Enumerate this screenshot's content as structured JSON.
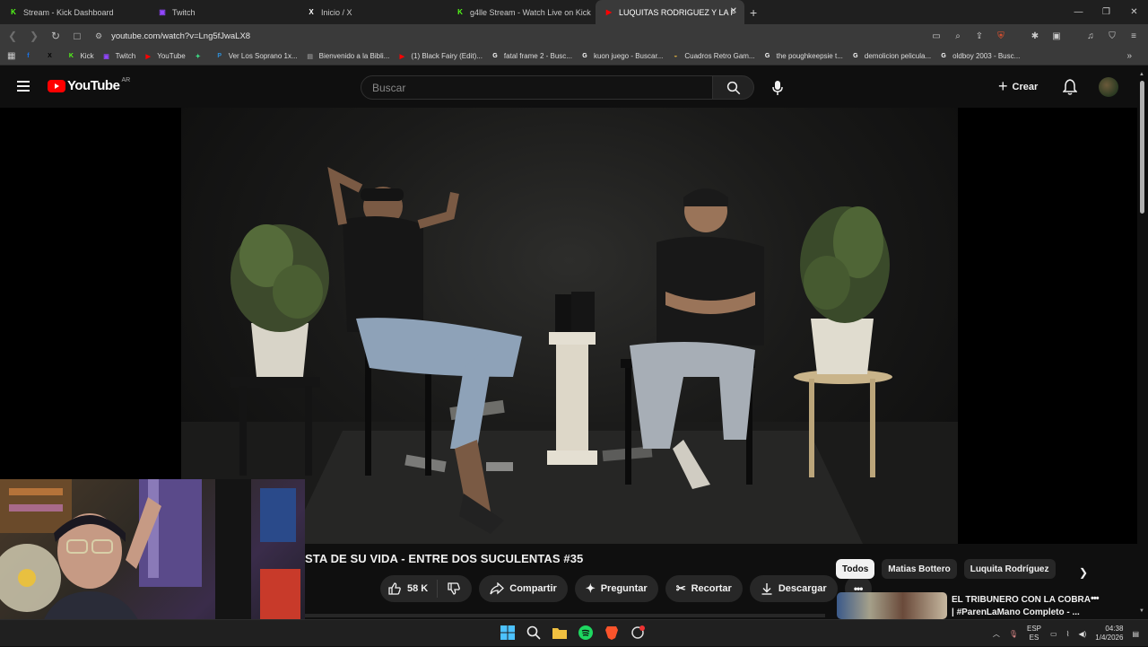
{
  "browser": {
    "tabs": [
      {
        "title": "Stream - Kick Dashboard",
        "icon": "kick-icon",
        "color": "#53fc18",
        "glyph": "K"
      },
      {
        "title": "Twitch",
        "icon": "twitch-icon",
        "color": "#9146ff",
        "glyph": "▣"
      },
      {
        "title": "Inicio / X",
        "icon": "x-icon",
        "color": "#ffffff",
        "glyph": "X"
      },
      {
        "title": "g4lle Stream - Watch Live on Kick",
        "icon": "kick-icon",
        "color": "#53fc18",
        "glyph": "K"
      },
      {
        "title": "LUQUITAS RODRIGUEZ Y LA F",
        "icon": "youtube-icon",
        "color": "#ff0000",
        "glyph": "▶",
        "active": true
      }
    ],
    "new_tab": "+",
    "address": "youtube.com/watch?v=Lng5fJwaLX8",
    "bookmarks": [
      {
        "label": "",
        "icon": "facebook-icon",
        "color": "#1877f2",
        "glyph": "f"
      },
      {
        "label": "",
        "icon": "x-icon",
        "color": "#000000",
        "glyph": "X"
      },
      {
        "label": "Kick",
        "icon": "kick-icon",
        "color": "#53fc18",
        "glyph": "K"
      },
      {
        "label": "Twitch",
        "icon": "twitch-icon",
        "color": "#9146ff",
        "glyph": "▣"
      },
      {
        "label": "YouTube",
        "icon": "youtube-icon",
        "color": "#ff0000",
        "glyph": "▶"
      },
      {
        "label": "",
        "icon": "android-icon",
        "color": "#3ddc84",
        "glyph": "✦"
      },
      {
        "label": "Ver Los Soprano 1x...",
        "icon": "site-icon",
        "color": "#2f8fd8",
        "glyph": "P"
      },
      {
        "label": "Bienvenido a la Bibli...",
        "icon": "doc-icon",
        "color": "#888888",
        "glyph": "▤"
      },
      {
        "label": "(1) Black Fairy (Edit)...",
        "icon": "youtube-icon",
        "color": "#ff0000",
        "glyph": "▶"
      },
      {
        "label": "fatal frame 2 - Busc...",
        "icon": "google-icon",
        "color": "#ffffff",
        "glyph": "G"
      },
      {
        "label": "kuon juego - Buscar...",
        "icon": "google-icon",
        "color": "#ffffff",
        "glyph": "G"
      },
      {
        "label": "Cuadros Retro Gam...",
        "icon": "site-icon",
        "color": "#c8a040",
        "glyph": "◒"
      },
      {
        "label": "the poughkeepsie t...",
        "icon": "google-icon",
        "color": "#ffffff",
        "glyph": "G"
      },
      {
        "label": "demolicion pelicula...",
        "icon": "google-icon",
        "color": "#ffffff",
        "glyph": "G"
      },
      {
        "label": "oldboy 2003 - Busc...",
        "icon": "google-icon",
        "color": "#ffffff",
        "glyph": "G"
      }
    ]
  },
  "youtube": {
    "logo_text": "YouTube",
    "country": "AR",
    "search_placeholder": "Buscar",
    "create_label": "Crear",
    "video_title": "STA DE SU VIDA - ENTRE DOS SUCULENTAS #35",
    "likes": "58 K",
    "actions": {
      "share": "Compartir",
      "ask": "Preguntar",
      "clip": "Recortar",
      "download": "Descargar"
    },
    "chips": [
      "Todos",
      "Matias Bottero",
      "Luquita Rodríguez"
    ],
    "recommended": {
      "title_line1": "EL TRIBUNERO CON LA COBRA",
      "title_line2": "| #ParenLaMano Completo - ..."
    },
    "accent": "#ff0000"
  },
  "taskbar": {
    "lang_top": "ESP",
    "lang_bottom": "ES",
    "time": "04:38",
    "date": "1/4/2026"
  }
}
